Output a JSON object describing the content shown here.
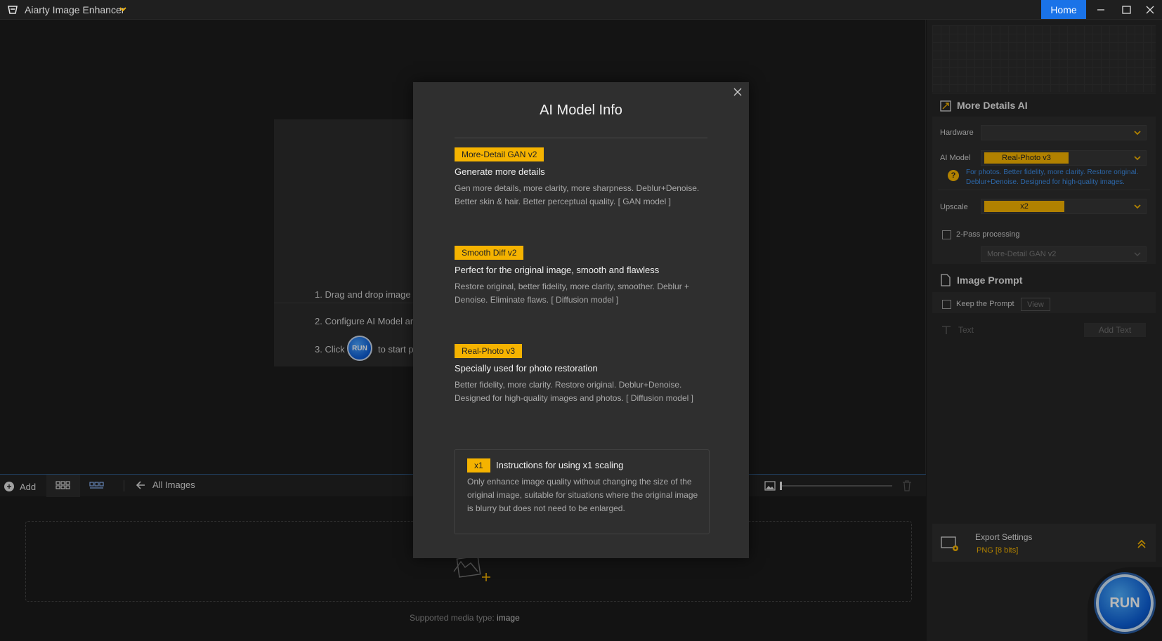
{
  "app": {
    "title": "Aiarty Image Enhancer",
    "home_label": "Home"
  },
  "workspace": {
    "step1": "1. Drag and drop image",
    "step2": "2. Configure AI Model ar",
    "step3_prefix": "3. Click",
    "step3_suffix": "to start p",
    "run_mini_label": "RUN"
  },
  "bottombar": {
    "add_label": "Add",
    "all_images_label": "All Images",
    "zoom_level": 0
  },
  "media": {
    "supported_prefix": "Supported media type:",
    "supported_type": "image"
  },
  "right_panel": {
    "section_title": "More Details AI",
    "hardware_label": "Hardware",
    "hardware_value": "",
    "ai_model_label": "AI Model",
    "ai_model_value": "Real-Photo v3",
    "ai_model_desc": "For photos. Better fidelity, more clarity. Restore original. Deblur+Denoise. Designed for high-quality images.",
    "upscale_label": "Upscale",
    "upscale_value": "x2",
    "twopass_label": "2-Pass processing",
    "twopass_model": "More-Detail GAN v2",
    "image_prompt_title": "Image Prompt",
    "keep_prompt_label": "Keep the Prompt",
    "view_label": "View",
    "text_label": "Text",
    "add_text_label": "Add Text",
    "export_title": "Export Settings",
    "export_format": "PNG   [8 bits]",
    "run_label": "RUN"
  },
  "modal": {
    "title": "AI Model Info",
    "models": [
      {
        "badge": "More-Detail GAN v2",
        "headline": "Generate more details",
        "desc": "Gen more details, more clarity, more sharpness. Deblur+Denoise. Better skin & hair. Better perceptual quality.  [ GAN model ]"
      },
      {
        "badge": "Smooth Diff v2",
        "headline": "Perfect for the original image, smooth and flawless",
        "desc": "Restore original, better fidelity, more clarity, smoother. Deblur + Denoise. Eliminate flaws.  [ Diffusion model ]"
      },
      {
        "badge": "Real-Photo v3",
        "headline": "Specially used for photo restoration",
        "desc": "Better fidelity, more clarity. Restore original. Deblur+Denoise. Designed for high-quality images and photos.  [ Diffusion model ]"
      }
    ],
    "x1": {
      "badge": "x1",
      "headline": "Instructions for using x1 scaling",
      "desc": "Only enhance image quality without changing the size of the original image, suitable for situations where the original image is blurry but does not need to be enlarged."
    }
  },
  "colors": {
    "accent": "#f5b300",
    "home_blue": "#1a73e8",
    "link_blue": "#3d8ee8"
  },
  "icons": [
    "app-logo-icon",
    "chevron-down-icon",
    "minimize-icon",
    "maximize-icon",
    "close-icon",
    "plus-circle-icon",
    "grid-view-icon",
    "list-view-icon",
    "arrow-left-icon",
    "image-icon",
    "trash-icon",
    "add-image-icon",
    "enhance-icon",
    "help-icon",
    "document-icon",
    "text-icon",
    "export-settings-icon",
    "double-chevron-up-icon"
  ]
}
